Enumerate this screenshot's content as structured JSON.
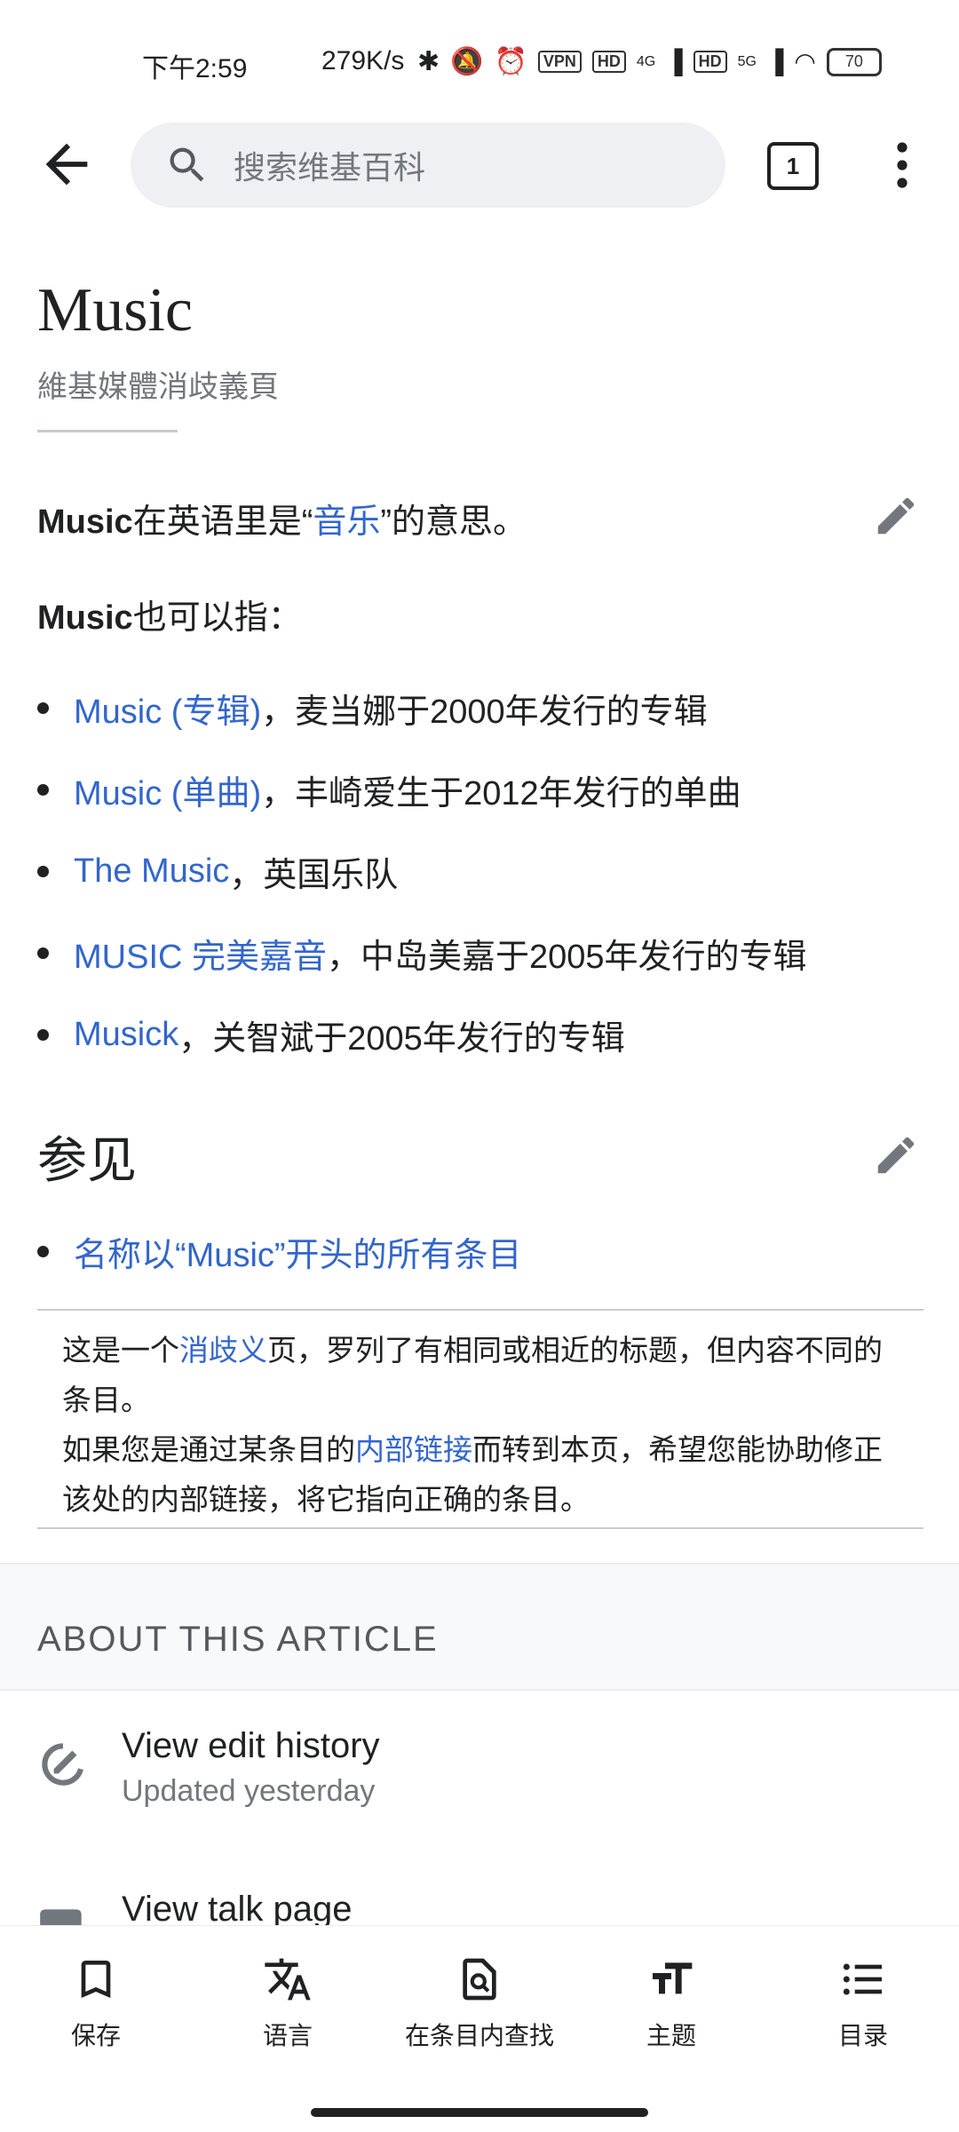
{
  "status_bar": {
    "time": "下午2:59",
    "speed": "279K/s",
    "vpn": "VPN",
    "hd": "HD",
    "net_4g": "4G",
    "net_5g": "5G",
    "battery": "70"
  },
  "top_bar": {
    "search_placeholder": "搜索维基百科",
    "tab_count": "1"
  },
  "article": {
    "title": "Music",
    "subtitle": "維基媒體消歧義頁",
    "intro": {
      "bold": "Music",
      "text_a": "在英语里是“",
      "link": "音乐",
      "text_b": "”的意思。"
    },
    "also": {
      "bold": "Music",
      "text": "也可以指："
    },
    "items": [
      {
        "link": "Music (专辑)",
        "text": "，麦当娜于2000年发行的专辑"
      },
      {
        "link": "Music (单曲)",
        "text": "，丰崎爱生于2012年发行的单曲"
      },
      {
        "link": "The Music",
        "text": "，英国乐队"
      },
      {
        "link": "MUSIC 完美嘉音",
        "text": "，中岛美嘉于2005年发行的专辑"
      },
      {
        "link": "Musick",
        "text": "，关智斌于2005年发行的专辑"
      }
    ],
    "see_also_heading": "参见",
    "see_also_items": [
      {
        "link": "名称以“Music”开头的所有条目"
      }
    ],
    "disambig": {
      "l1_a": "这是一个",
      "l1_link": "消歧义",
      "l1_b": "页，罗列了有相同或相近的标题，但内容不同的",
      "l2": "条目。",
      "l3_a": "如果您是通过某条目的",
      "l3_link": "内部链接",
      "l3_b": "而转到本页，希望您能协助修正",
      "l4": "该处的内部链接，将它指向正确的条目。"
    }
  },
  "about": {
    "heading": "ABOUT THIS ARTICLE",
    "rows": [
      {
        "title": "View edit history",
        "subtitle": "Updated yesterday"
      },
      {
        "title": "View talk page"
      }
    ]
  },
  "bottom_nav": {
    "items": [
      {
        "label": "保存",
        "icon": "bookmark-icon"
      },
      {
        "label": "语言",
        "icon": "translate-icon"
      },
      {
        "label": "在条目内查找",
        "icon": "find-in-page-icon"
      },
      {
        "label": "主题",
        "icon": "text-size-icon"
      },
      {
        "label": "目录",
        "icon": "list-icon"
      }
    ]
  }
}
